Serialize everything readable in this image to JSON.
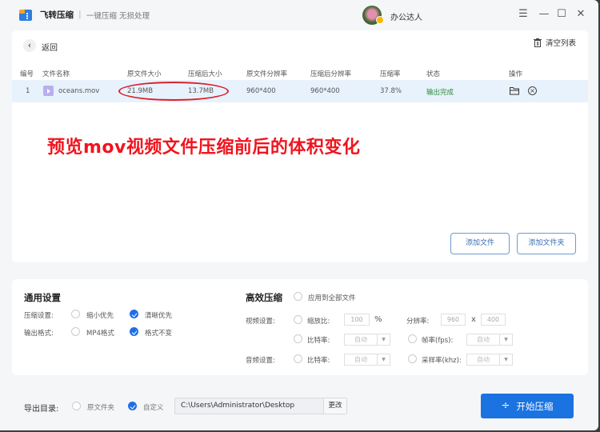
{
  "app": {
    "name": "飞转压缩",
    "separator": "|",
    "slogan": "一键压缩 无损处理",
    "username": "办公达人",
    "window_controls": {
      "menu": "☰",
      "minimize": "—",
      "maximize": "☐",
      "close": "✕"
    }
  },
  "toolbar": {
    "back_icon": "‹",
    "back_label": "返回",
    "clear_label": "清空列表"
  },
  "table": {
    "headers": [
      "编号",
      "文件名称",
      "原文件大小",
      "压缩后大小",
      "原文件分辨率",
      "压缩后分辨率",
      "压缩率",
      "状态",
      "操作"
    ],
    "rows": [
      {
        "index": "1",
        "name": "oceans.mov",
        "original_size": "21.9MB",
        "compressed_size": "13.7MB",
        "original_resolution": "960*400",
        "compressed_resolution": "960*400",
        "ratio": "37.8%",
        "status": "输出完成"
      }
    ]
  },
  "annotation": "预览mov视频文件压缩前后的体积变化",
  "add_buttons": {
    "add_file": "添加文件",
    "add_folder": "添加文件夹"
  },
  "general": {
    "title": "通用设置",
    "compress_label": "压缩设置:",
    "compress_options": [
      {
        "label": "缩小优先",
        "checked": false
      },
      {
        "label": "清晰优先",
        "checked": true
      }
    ],
    "format_label": "输出格式:",
    "format_options": [
      {
        "label": "MP4格式",
        "checked": false
      },
      {
        "label": "格式不变",
        "checked": true
      }
    ]
  },
  "advanced": {
    "title": "高效压缩",
    "apply_all": "应用到全部文件",
    "video_label": "视频设置:",
    "scale_label": "缩放比:",
    "scale_value": "100",
    "scale_unit": "%",
    "resolution_label": "分辨率:",
    "res_w": "960",
    "res_x": "x",
    "res_h": "400",
    "bitrate_label": "比特率:",
    "bitrate_value": "自动",
    "fps_label": "帧率(fps):",
    "fps_value": "自动",
    "audio_label": "音频设置:",
    "audio_bitrate_label": "比特率:",
    "audio_bitrate_value": "自动",
    "sample_label": "采样率(khz):",
    "sample_value": "自动",
    "dropdown_arrow": "▼"
  },
  "output": {
    "label": "导出目录:",
    "options": [
      {
        "label": "原文件夹",
        "checked": false
      },
      {
        "label": "自定义",
        "checked": true
      }
    ],
    "path": "C:\\Users\\Administrator\\Desktop",
    "change_label": "更改",
    "start_label": "开始压缩",
    "start_icon": "÷"
  },
  "colors": {
    "accent": "#1a73e0",
    "status_done": "#2e8b3a",
    "annotation": "#f0141e",
    "highlight": "#d9222a"
  }
}
